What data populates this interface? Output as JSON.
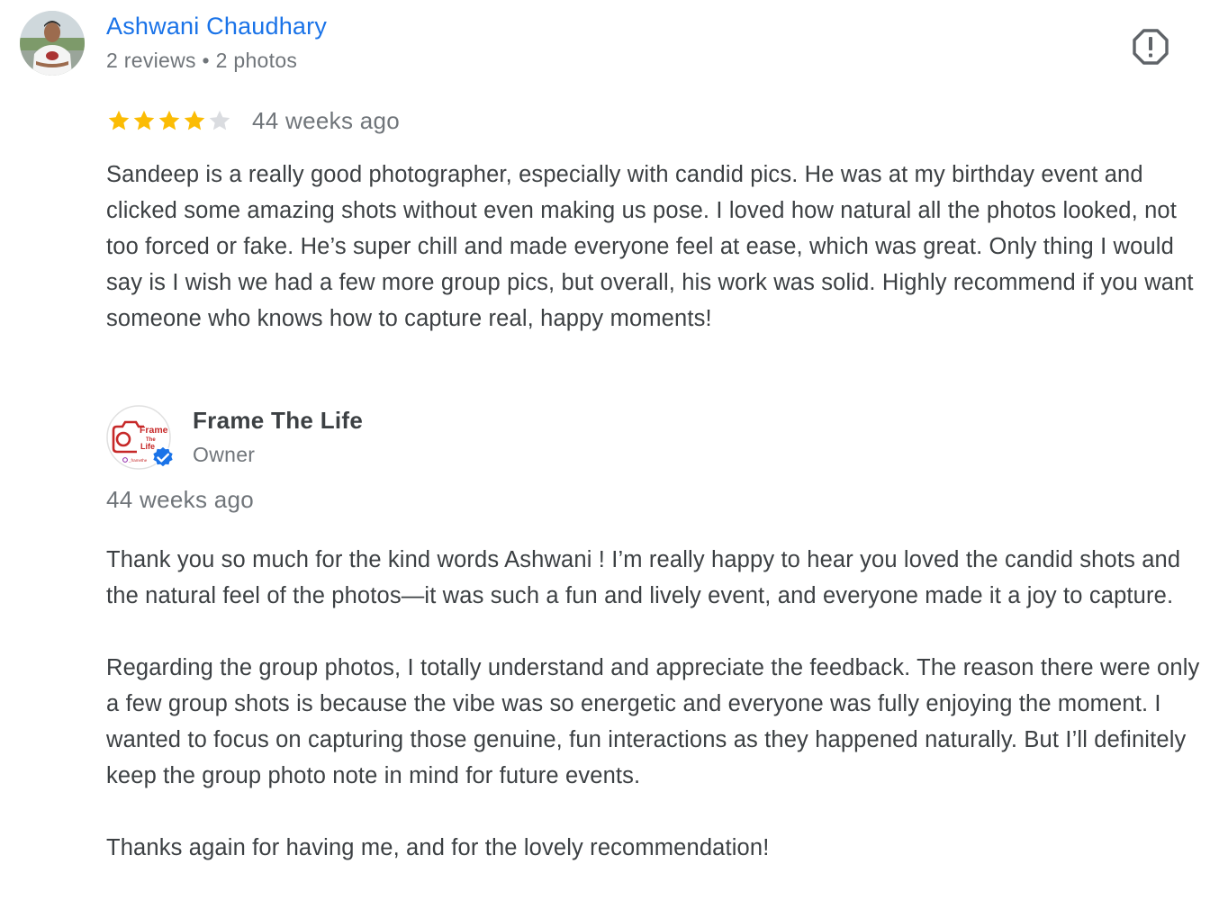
{
  "review": {
    "author": {
      "name": "Ashwani Chaudhary",
      "meta": "2 reviews • 2 photos",
      "avatar_icon": "user-photo"
    },
    "rating": {
      "stars_filled": 4,
      "stars_total": 5,
      "filled_color": "#fbbc04",
      "empty_color": "#dadce0"
    },
    "date": "44 weeks ago",
    "text": "Sandeep is a really good photographer, especially with candid pics. He was at my birthday event and clicked some amazing shots without even making us pose. I loved how natural all the photos looked, not too forced or fake. He’s super chill and made everyone feel at ease, which was great. Only thing I would say is I wish we had a few more group pics, but overall, his work was solid. Highly recommend if you want someone who knows how to capture real, happy moments!",
    "report_icon": "report-flag-icon"
  },
  "reply": {
    "owner": {
      "name": "Frame The Life",
      "role": "Owner",
      "logo": {
        "text_line1": "Frame",
        "text_line2": "The",
        "text_line3": "Life",
        "handle": "_framethe",
        "brand_color": "#c62828",
        "verified_color": "#1a73e8"
      }
    },
    "date": "44 weeks ago",
    "paragraphs": [
      "Thank you so much for the kind words Ashwani ! I’m really happy to hear you loved the candid shots and the natural feel of the photos—it was such a fun and lively event, and everyone made it a joy to capture.",
      "Regarding the group photos, I totally understand and appreciate the feedback. The reason there were only a few group shots is because the vibe was so energetic and everyone was fully enjoying the moment. I wanted to focus on capturing those genuine, fun interactions as they happened naturally. But I’ll definitely keep the group photo note in mind for future events.",
      "Thanks again for having me, and for the lovely recommendation!"
    ]
  },
  "colors": {
    "link_blue": "#1a73e8",
    "secondary_text": "#70757a",
    "body_text": "#3c4043"
  }
}
